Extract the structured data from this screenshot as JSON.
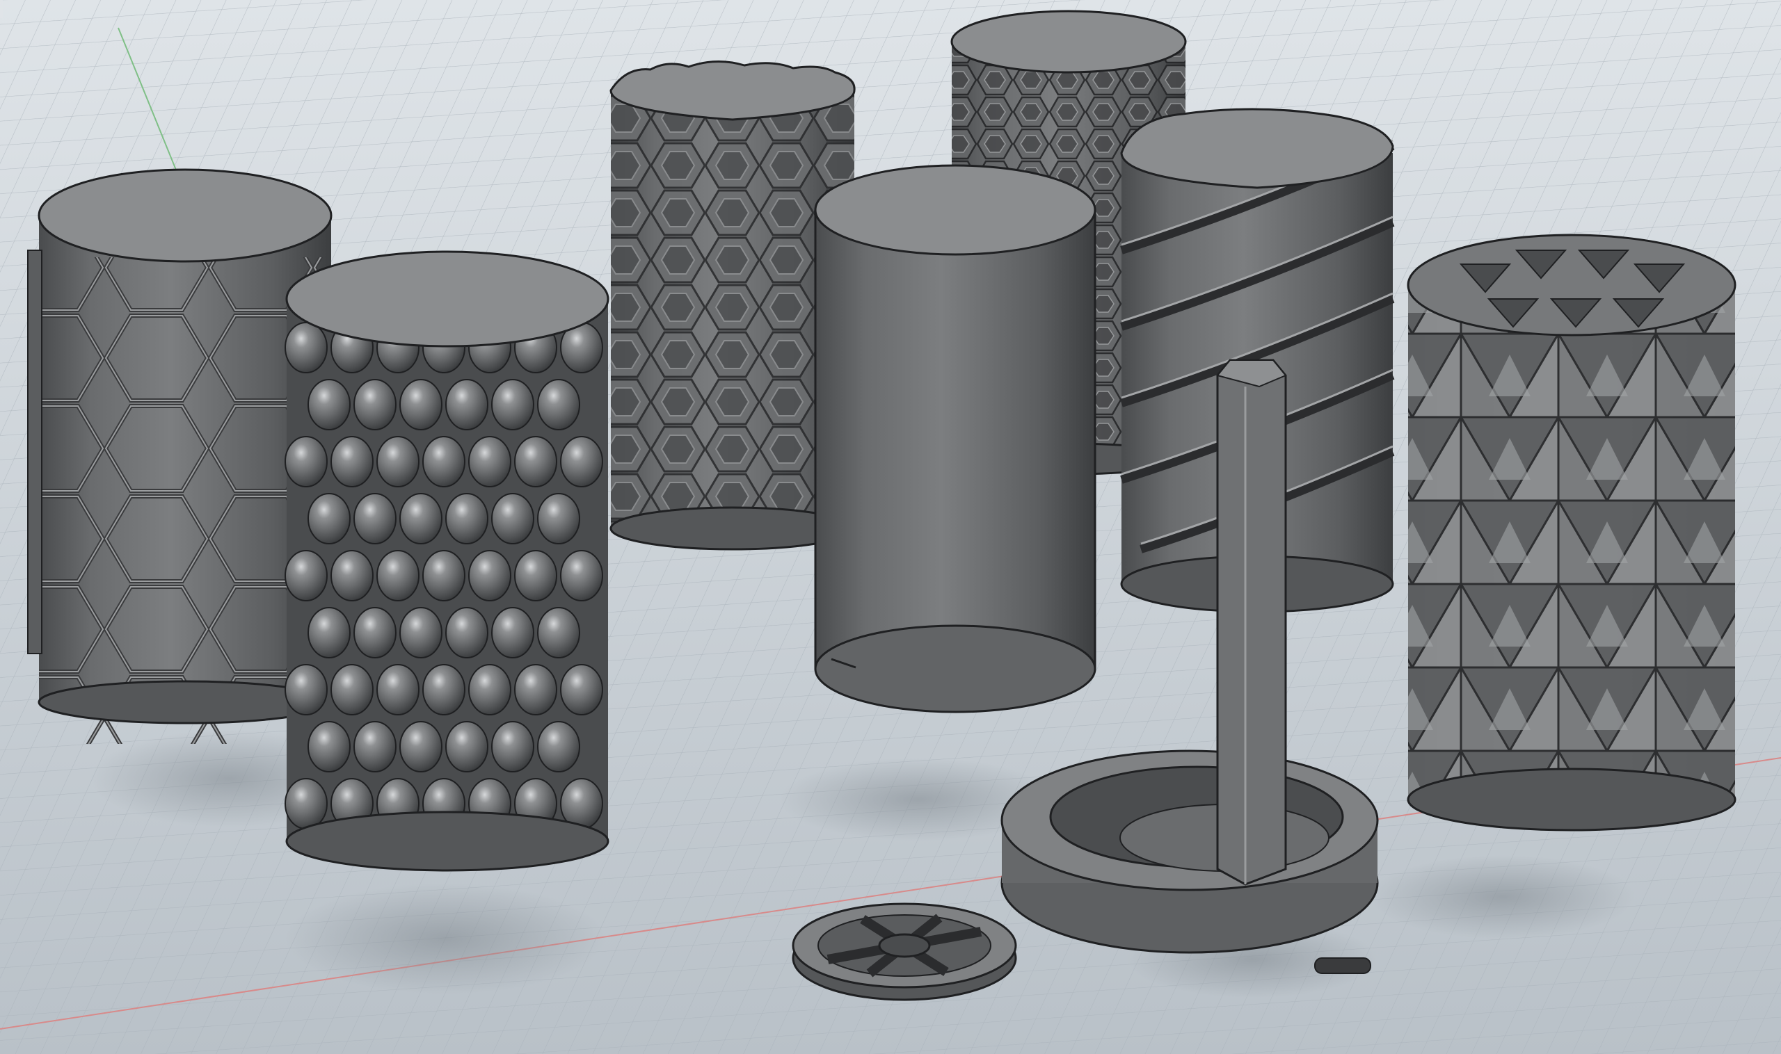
{
  "viewport": {
    "background_top": "#dfe4e8",
    "background_bottom": "#b9c1c8",
    "grid_color": "#a9b2ba",
    "axis_x_color": "#d88a8a",
    "axis_y_color": "#7fbf86"
  },
  "material": {
    "body": "#6f7173",
    "body_dark": "#3e4042",
    "body_light": "#9a9c9e",
    "top_face": "#8b8d8f",
    "edge": "#1f2022"
  },
  "models": [
    {
      "name": "hexagon-relief-sleeve",
      "pattern": "hexagon-outline"
    },
    {
      "name": "sphere-bubble-sleeve",
      "pattern": "spheres"
    },
    {
      "name": "honeycomb-sleeve-back",
      "pattern": "honeycomb"
    },
    {
      "name": "honeycomb-sleeve-small",
      "pattern": "honeycomb"
    },
    {
      "name": "plain-sleeve",
      "pattern": "plain"
    },
    {
      "name": "spiral-groove-sleeve",
      "pattern": "spiral"
    },
    {
      "name": "triangle-facet-sleeve",
      "pattern": "triangles"
    },
    {
      "name": "hex-core-base",
      "pattern": "core"
    },
    {
      "name": "spoked-lid",
      "pattern": "spokes"
    }
  ]
}
